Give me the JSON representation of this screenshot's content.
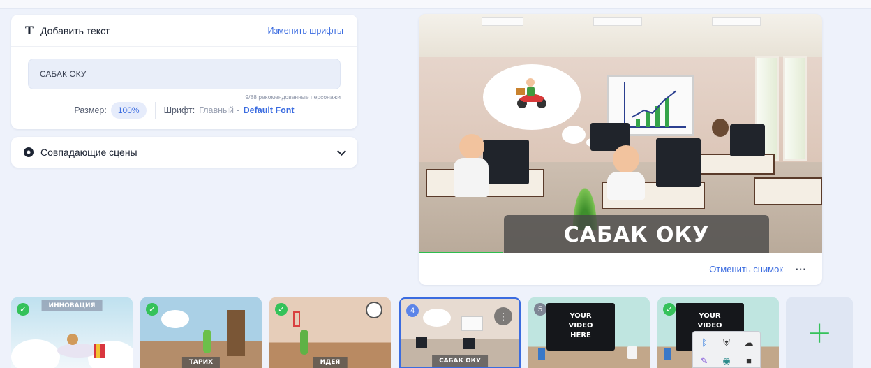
{
  "text_panel": {
    "title": "Добавить текст",
    "change_fonts_link": "Изменить шрифты",
    "text_value": "САБАК ОКУ",
    "char_hint": "9/88 рекомендованные персонажи",
    "size_label": "Размер:",
    "size_value": "100%",
    "font_label": "Шрифт:",
    "font_main": "Главный -",
    "font_name": "Default Font"
  },
  "scenes_panel": {
    "title": "Совпадающие сцены"
  },
  "preview": {
    "caption": "САБАК ОКУ",
    "undo_link": "Отменить снимок",
    "more_label": "···",
    "progress": 0.21
  },
  "filmstrip": {
    "thumbs": [
      {
        "label": "ИННОВАЦИЯ",
        "status": "done"
      },
      {
        "label": "ТАРИХ",
        "status": "done"
      },
      {
        "label": "ИДЕЯ",
        "status": "done"
      },
      {
        "number": "4",
        "label": "САБАК ОКУ",
        "status": "selected",
        "menu": "⋮"
      },
      {
        "number": "5",
        "screen_text": "YOUR\nVIDEO\nHERE",
        "status": "pending"
      },
      {
        "screen_text": "YOUR\nVIDEO\nHERE",
        "status": "done"
      }
    ],
    "check_glyph": "✓",
    "add_glyph": "+"
  },
  "colors": {
    "accent": "#3b6ce0",
    "success": "#35c25a",
    "background": "#eef2fb"
  },
  "icons": {
    "text": "T",
    "scenes": "gear-icon",
    "expand": "chevron-down-icon"
  }
}
